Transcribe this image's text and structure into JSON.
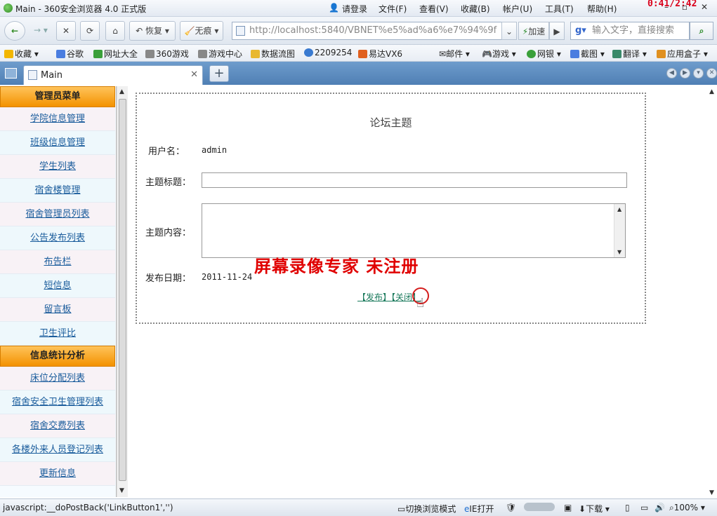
{
  "window": {
    "title": "Main - 360安全浏览器 4.0 正式版",
    "timer": "0:41/2:42",
    "menus": [
      "请登录",
      "文件(F)",
      "查看(V)",
      "收藏(B)",
      "帐户(U)",
      "工具(T)",
      "帮助(H)"
    ]
  },
  "nav": {
    "restore_label": "恢复",
    "notrace_label": "无痕",
    "address": "http://localhost:5840/VBNET%e5%ad%a6%e7%94%9f",
    "speed_label": "加速",
    "search_placeholder": "输入文字，直接搜索"
  },
  "favorites": {
    "items": [
      "收藏",
      "谷歌",
      "网址大全",
      "360游戏",
      "游戏中心",
      "数据流图",
      "2209254",
      "易达VX6"
    ],
    "right_items": [
      "邮件",
      "游戏",
      "网银",
      "截图",
      "翻译",
      "应用盒子"
    ]
  },
  "tabs": {
    "active_label": "Main"
  },
  "sidebar": {
    "section1": "管理员菜单",
    "items1": [
      "学院信息管理",
      "班级信息管理",
      "学生列表",
      "宿舍楼管理",
      "宿舍管理员列表",
      "公告发布列表",
      "布告栏",
      "短信息",
      "留言板",
      "卫生评比"
    ],
    "section2": "信息统计分析",
    "items2": [
      "床位分配列表",
      "宿舍安全卫生管理列表",
      "宿舍交费列表",
      "各楼外来人员登记列表",
      "更新信息"
    ]
  },
  "form": {
    "title": "论坛主题",
    "username_label": "用户名：",
    "username_value": "admin",
    "subject_label": "主题标题：",
    "subject_value": "",
    "content_label": "主题内容：",
    "content_value": "",
    "date_label": "发布日期：",
    "date_value": "2011-11-24",
    "publish_link": "【发布】",
    "close_link": "【关闭】"
  },
  "watermark": "屏幕录像专家  未注册",
  "status": {
    "text": "javascript:__doPostBack('LinkButton1','')",
    "mode_label": "切换浏览模式",
    "ie_label": "IE打开",
    "download_label": "下载",
    "zoom": "100%"
  }
}
